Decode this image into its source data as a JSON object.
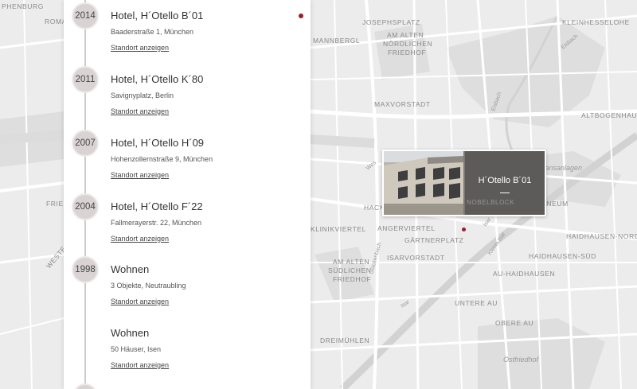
{
  "map": {
    "districts": [
      {
        "id": "josephsplatz",
        "text": "JOSEPHSPLATZ"
      },
      {
        "id": "alter-nord-1",
        "text": "AM ALTEN"
      },
      {
        "id": "alter-nord-2",
        "text": "NÖRDLICHEN"
      },
      {
        "id": "alter-nord-3",
        "text": "FRIEDHOF"
      },
      {
        "id": "maxvorstadt",
        "text": "MAXVORSTADT"
      },
      {
        "id": "kleinhesselohe",
        "text": "KLEINHESSELOHE"
      },
      {
        "id": "altbogenhausen",
        "text": "ALTBOGENHAUSEN"
      },
      {
        "id": "nymphenburg",
        "text": "PHENBURG"
      },
      {
        "id": "romanplatz",
        "text": "ROMAN"
      },
      {
        "id": "mannbergl",
        "text": "MANNBERGL"
      },
      {
        "id": "hack",
        "text": "HACK"
      },
      {
        "id": "friedenheim",
        "text": "FRIED"
      },
      {
        "id": "angerviertel",
        "text": "ANGERVIERTEL"
      },
      {
        "id": "klinikviertel",
        "text": "KLINIKVIERTEL"
      },
      {
        "id": "gaertnerplatz",
        "text": "GÄRTNERPLATZ"
      },
      {
        "id": "isarvorstadt",
        "text": "ISARVORSTADT"
      },
      {
        "id": "alter-sued-1",
        "text": "AM ALTEN"
      },
      {
        "id": "alter-sued-2",
        "text": "SÜDLICHEN"
      },
      {
        "id": "alter-sued-3",
        "text": "FRIEDHOF"
      },
      {
        "id": "maximaneum",
        "text": "MAXIMILIANEUM"
      },
      {
        "id": "haidhausen-nord",
        "text": "HAIDHAUSEN-NORD"
      },
      {
        "id": "haidhausen-sued",
        "text": "HAIDHAUSEN-SÜD"
      },
      {
        "id": "au-haidhausen",
        "text": "AU-HAIDHAUSEN"
      },
      {
        "id": "untere-au",
        "text": "UNTERE AU"
      },
      {
        "id": "obere-au",
        "text": "OBERE AU"
      },
      {
        "id": "dreimuehlen",
        "text": "DREIMÜHLEN"
      },
      {
        "id": "westend",
        "text": "WESTE"
      }
    ],
    "parks": [
      {
        "id": "ostfriedhof",
        "text": "Ostfriedhof"
      },
      {
        "id": "maximiliansanlagen",
        "text": "Maximiliansanlagen"
      }
    ],
    "streets": [
      {
        "id": "eisbach",
        "text": "Eisbach"
      },
      {
        "id": "eisbach2",
        "text": "Eisbach"
      },
      {
        "id": "wes",
        "text": "Wes"
      },
      {
        "id": "glueckenbach",
        "text": "Glückenbach"
      },
      {
        "id": "isar",
        "text": "Isar"
      },
      {
        "id": "kleine-isar",
        "text": "Kleine Isar"
      },
      {
        "id": "isar2",
        "text": "Isar"
      }
    ],
    "colors": {
      "background": "#ececec",
      "road": "#ffffff",
      "park": "#dedede",
      "water": "#d2d2d2",
      "marker": "#9b1c2e"
    }
  },
  "timeline": {
    "entries": [
      {
        "year": "2014",
        "title": "Hotel, H´Otello B´01",
        "subtitle": "Baaderstraße 1, München",
        "link": "Standort anzeigen",
        "active": true
      },
      {
        "year": "2011",
        "title": "Hotel, H´Otello K´80",
        "subtitle": "Savignyplatz, Berlin",
        "link": "Standort anzeigen",
        "active": false
      },
      {
        "year": "2007",
        "title": "Hotel, H´Otello H´09",
        "subtitle": "Hohenzollernstraße 9, München",
        "link": "Standort anzeigen",
        "active": false
      },
      {
        "year": "2004",
        "title": "Hotel, H´Otello F´22",
        "subtitle": "Fallmerayerstr. 22, München",
        "link": "Standort anzeigen",
        "active": false
      },
      {
        "year": "1998",
        "title": "Wohnen",
        "subtitle": "3 Objekte, Neutraubling",
        "link": "Standort anzeigen",
        "active": false
      },
      {
        "year": "",
        "title": "Wohnen",
        "subtitle": "50 Häuser, Isen",
        "link": "Standort anzeigen",
        "active": false
      }
    ]
  },
  "popup": {
    "title": "H´Otello B´01",
    "ghost_text": "NOBELBLOCK"
  }
}
